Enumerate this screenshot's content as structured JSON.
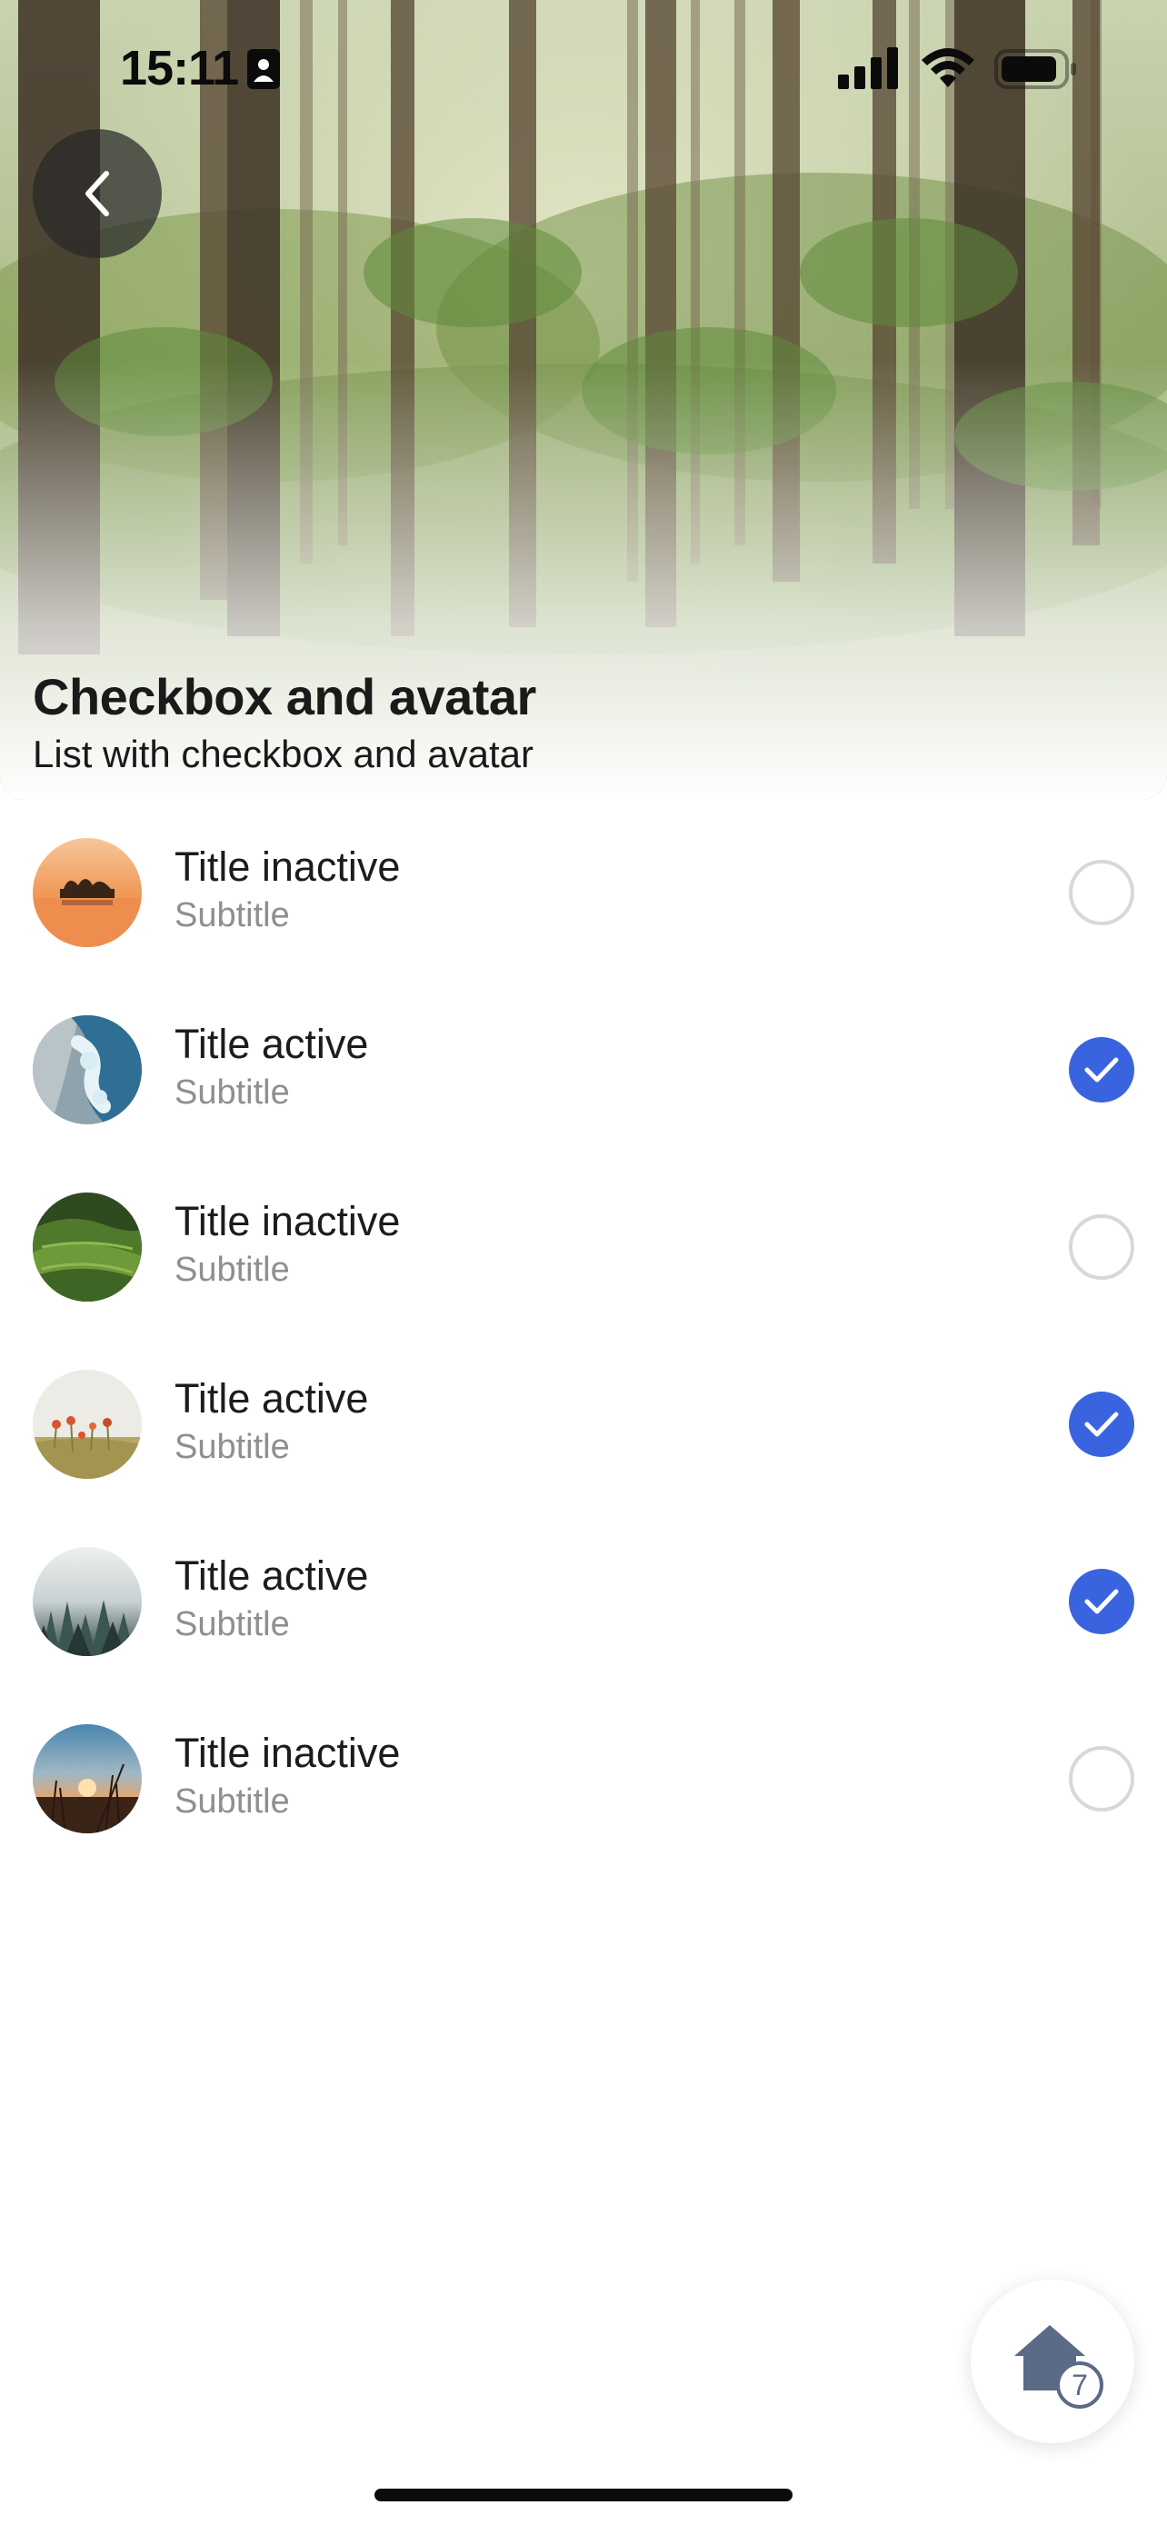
{
  "status_bar": {
    "time": "15:11",
    "icons": [
      "contact-card-icon",
      "signal-icon",
      "wifi-icon",
      "battery-icon"
    ]
  },
  "header": {
    "back_icon": "chevron-left-icon",
    "title": "Checkbox and avatar",
    "subtitle": "List with checkbox and avatar"
  },
  "list": {
    "items": [
      {
        "title": "Title inactive",
        "subtitle": "Subtitle",
        "checked": false,
        "avatar": "sunset-lake"
      },
      {
        "title": "Title active",
        "subtitle": "Subtitle",
        "checked": true,
        "avatar": "ocean-wave"
      },
      {
        "title": "Title inactive",
        "subtitle": "Subtitle",
        "checked": false,
        "avatar": "green-hills"
      },
      {
        "title": "Title active",
        "subtitle": "Subtitle",
        "checked": true,
        "avatar": "wildflowers"
      },
      {
        "title": "Title active",
        "subtitle": "Subtitle",
        "checked": true,
        "avatar": "misty-forest"
      },
      {
        "title": "Title inactive",
        "subtitle": "Subtitle",
        "checked": false,
        "avatar": "sunset-grass"
      }
    ]
  },
  "fab": {
    "icon": "home-icon",
    "badge": "7"
  },
  "colors": {
    "accent": "#3a63e0",
    "checkbox_border": "#d8d8dc",
    "subtitle": "#8e8e93",
    "text": "#1c1c1e"
  }
}
